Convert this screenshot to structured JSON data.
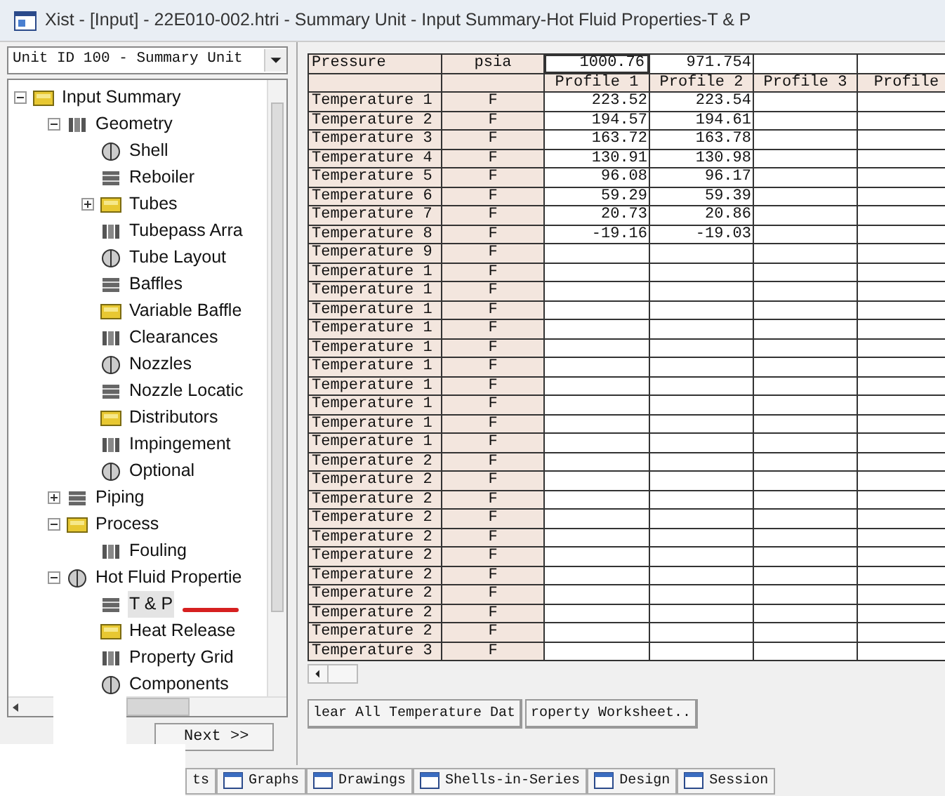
{
  "window": {
    "title": "Xist - [Input] - 22E010-002.htri - Summary Unit - Input Summary-Hot Fluid Properties-T & P"
  },
  "unit_selector": {
    "value": "Unit ID 100 - Summary Unit"
  },
  "tree": [
    {
      "label": "Input Summary",
      "expanded": true,
      "selected": false,
      "children": [
        {
          "label": "Geometry",
          "expanded": true,
          "selected": false,
          "children": [
            {
              "label": "Shell",
              "selected": false
            },
            {
              "label": "Reboiler",
              "selected": false
            },
            {
              "label": "Tubes",
              "expanded": false,
              "selected": false
            },
            {
              "label": "Tubepass Arra",
              "selected": false
            },
            {
              "label": "Tube Layout",
              "selected": false
            },
            {
              "label": "Baffles",
              "selected": false
            },
            {
              "label": "Variable Baffle",
              "selected": false
            },
            {
              "label": "Clearances",
              "selected": false
            },
            {
              "label": "Nozzles",
              "selected": false
            },
            {
              "label": "Nozzle Locatic",
              "selected": false
            },
            {
              "label": "Distributors",
              "selected": false
            },
            {
              "label": "Impingement",
              "selected": false
            },
            {
              "label": "Optional",
              "selected": false
            }
          ]
        },
        {
          "label": "Piping",
          "expanded": false,
          "selected": false
        },
        {
          "label": "Process",
          "expanded": true,
          "selected": false,
          "children": [
            {
              "label": "Fouling",
              "selected": false
            }
          ]
        },
        {
          "label": "Hot Fluid Propertie",
          "expanded": true,
          "selected": false,
          "children": [
            {
              "label": "T & P",
              "selected": true
            },
            {
              "label": "Heat Release",
              "selected": false
            },
            {
              "label": "Property Grid",
              "selected": false
            },
            {
              "label": "Components",
              "selected": false
            }
          ]
        }
      ]
    }
  ],
  "next_button": "Next >>",
  "table": {
    "pressure": {
      "label": "Pressure",
      "unit": "psia",
      "values": [
        "1000.76",
        "971.754"
      ]
    },
    "profiles": [
      "Profile 1",
      "Profile 2",
      "Profile 3",
      "Profile"
    ],
    "rows": [
      {
        "name": "Temperature 1",
        "unit": "F",
        "values": [
          "223.52",
          "223.54"
        ]
      },
      {
        "name": "Temperature 2",
        "unit": "F",
        "values": [
          "194.57",
          "194.61"
        ]
      },
      {
        "name": "Temperature 3",
        "unit": "F",
        "values": [
          "163.72",
          "163.78"
        ]
      },
      {
        "name": "Temperature 4",
        "unit": "F",
        "values": [
          "130.91",
          "130.98"
        ]
      },
      {
        "name": "Temperature 5",
        "unit": "F",
        "values": [
          "96.08",
          "96.17"
        ]
      },
      {
        "name": "Temperature 6",
        "unit": "F",
        "values": [
          "59.29",
          "59.39"
        ]
      },
      {
        "name": "Temperature 7",
        "unit": "F",
        "values": [
          "20.73",
          "20.86"
        ]
      },
      {
        "name": "Temperature 8",
        "unit": "F",
        "values": [
          "-19.16",
          "-19.03"
        ]
      },
      {
        "name": "Temperature 9",
        "unit": "F",
        "values": []
      },
      {
        "name": "Temperature 1",
        "unit": "F",
        "values": []
      },
      {
        "name": "Temperature 1",
        "unit": "F",
        "values": []
      },
      {
        "name": "Temperature 1",
        "unit": "F",
        "values": []
      },
      {
        "name": "Temperature 1",
        "unit": "F",
        "values": []
      },
      {
        "name": "Temperature 1",
        "unit": "F",
        "values": []
      },
      {
        "name": "Temperature 1",
        "unit": "F",
        "values": []
      },
      {
        "name": "Temperature 1",
        "unit": "F",
        "values": []
      },
      {
        "name": "Temperature 1",
        "unit": "F",
        "values": []
      },
      {
        "name": "Temperature 1",
        "unit": "F",
        "values": []
      },
      {
        "name": "Temperature 1",
        "unit": "F",
        "values": []
      },
      {
        "name": "Temperature 2",
        "unit": "F",
        "values": []
      },
      {
        "name": "Temperature 2",
        "unit": "F",
        "values": []
      },
      {
        "name": "Temperature 2",
        "unit": "F",
        "values": []
      },
      {
        "name": "Temperature 2",
        "unit": "F",
        "values": []
      },
      {
        "name": "Temperature 2",
        "unit": "F",
        "values": []
      },
      {
        "name": "Temperature 2",
        "unit": "F",
        "values": []
      },
      {
        "name": "Temperature 2",
        "unit": "F",
        "values": []
      },
      {
        "name": "Temperature 2",
        "unit": "F",
        "values": []
      },
      {
        "name": "Temperature 2",
        "unit": "F",
        "values": []
      },
      {
        "name": "Temperature 2",
        "unit": "F",
        "values": []
      },
      {
        "name": "Temperature 3",
        "unit": "F",
        "values": []
      }
    ]
  },
  "actions": [
    "lear All Temperature Dat",
    "roperty Worksheet.."
  ],
  "bottom_tabs": [
    "ts",
    "Graphs",
    "Drawings",
    "Shells-in-Series",
    "Design",
    "Session"
  ]
}
